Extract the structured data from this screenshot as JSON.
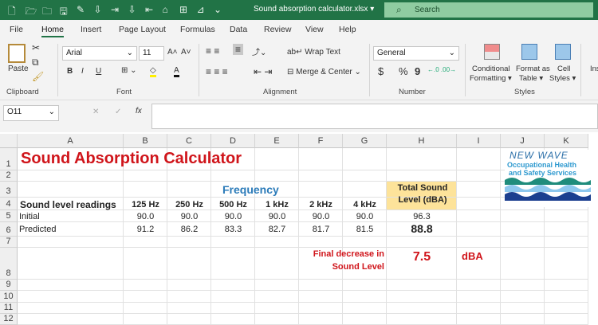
{
  "window": {
    "title": "Sound absorption calculator.xlsx ▾",
    "search_placeholder": "Search"
  },
  "quick_access_icons": [
    "new-icon",
    "open-icon",
    "folder-icon",
    "save-icon",
    "edit-icon",
    "insert-icon",
    "insert-col-icon",
    "delete-icon",
    "delete-col-icon",
    "format-painter-icon",
    "table-icon",
    "chart-icon",
    "customize-icon"
  ],
  "menu": [
    "File",
    "Home",
    "Insert",
    "Page Layout",
    "Formulas",
    "Data",
    "Review",
    "View",
    "Help"
  ],
  "ribbon": {
    "clipboard": {
      "paste": "Paste",
      "label": "Clipboard"
    },
    "font": {
      "name": "Arial",
      "size": "11",
      "label": "Font",
      "bold": "B",
      "italic": "I",
      "underline": "U"
    },
    "alignment": {
      "wrap": "Wrap Text",
      "merge": "Merge & Center",
      "label": "Alignment"
    },
    "number": {
      "format": "General",
      "currency": "$",
      "percent": "%",
      "comma": "9",
      "label": "Number"
    },
    "styles": {
      "conditional1": "Conditional",
      "conditional2": "Formatting ▾",
      "table1": "Format as",
      "table2": "Table ▾",
      "cell1": "Cell",
      "cell2": "Styles ▾",
      "label": "Styles"
    },
    "cells": {
      "insert": "Ins"
    }
  },
  "formula_bar": {
    "name_box": "O11",
    "fx": "fx",
    "cancel": "✕",
    "enter": "✓",
    "value": ""
  },
  "columns": [
    "A",
    "B",
    "C",
    "D",
    "E",
    "F",
    "G",
    "H",
    "I",
    "J",
    "K"
  ],
  "rows": [
    "1",
    "2",
    "3",
    "4",
    "5",
    "6",
    "7",
    "8",
    "9",
    "10",
    "11",
    "12"
  ],
  "sheet": {
    "title": "Sound Absorption Calculator",
    "frequency": "Frequency",
    "readings_header": "Sound level readings",
    "bands": [
      "125 Hz",
      "250 Hz",
      "500 Hz",
      "1 kHz",
      "2 kHz",
      "4 kHz"
    ],
    "total_header1": "Total Sound",
    "total_header2": "Level (dBA)",
    "initial": {
      "label": "Initial",
      "values": [
        "90.0",
        "90.0",
        "90.0",
        "90.0",
        "90.0",
        "90.0"
      ],
      "total": "96.3"
    },
    "predicted": {
      "label": "Predicted",
      "values": [
        "91.2",
        "86.2",
        "83.3",
        "82.7",
        "81.7",
        "81.5"
      ],
      "total": "88.8"
    },
    "decrease_label1": "Final decrease in",
    "decrease_label2": "Sound Level",
    "decrease_value": "7.5",
    "decrease_unit": "dBA"
  },
  "logo": {
    "line1": "NEW WAVE",
    "line2": "Occupational Health",
    "line3": "and Safety Services"
  },
  "colors": {
    "excel_green": "#217346",
    "title_red": "#d0151b",
    "frequency_blue": "#2b7bb9",
    "total_fill": "#fde39a"
  }
}
